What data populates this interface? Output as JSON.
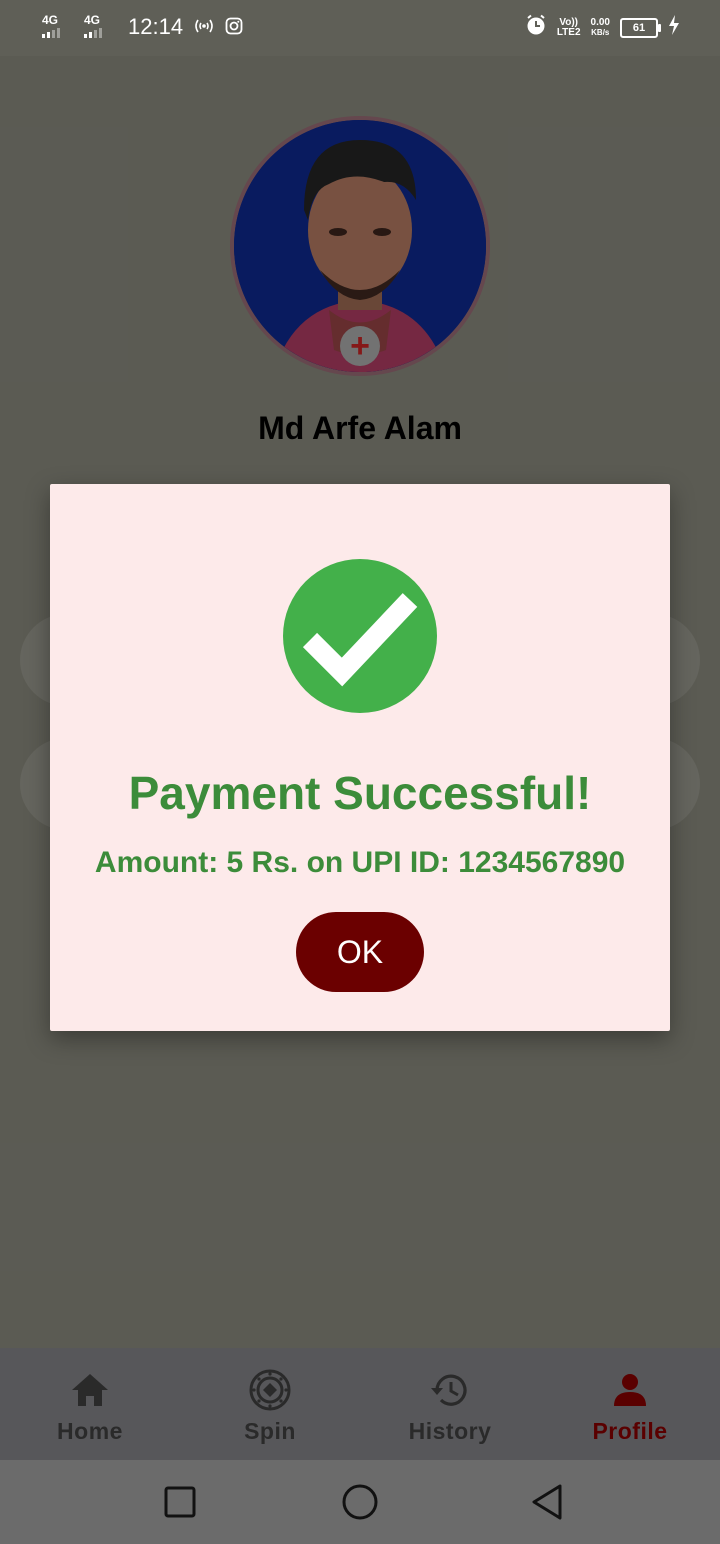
{
  "status_bar": {
    "network1": "4G",
    "network2": "4G",
    "time": "12:14",
    "volte": "Vo))",
    "lte": "LTE2",
    "speed_value": "0.00",
    "speed_unit": "KB/s",
    "battery": "61"
  },
  "profile": {
    "name": "Md Arfe Alam",
    "add_symbol": "+"
  },
  "dialog": {
    "title": "Payment Successful!",
    "message": "Amount: 5 Rs. on UPI ID: 1234567890",
    "ok_label": "OK",
    "accent_color": "#3c8c3a",
    "button_color": "#6b0000"
  },
  "bottom_nav": {
    "items": [
      {
        "label": "Home",
        "icon": "home-icon"
      },
      {
        "label": "Spin",
        "icon": "spin-wheel-icon"
      },
      {
        "label": "History",
        "icon": "history-icon"
      },
      {
        "label": "Profile",
        "icon": "person-icon"
      }
    ],
    "active": "Profile"
  },
  "system_nav": {
    "buttons": [
      "recents-icon",
      "home-circle-icon",
      "back-icon"
    ]
  }
}
